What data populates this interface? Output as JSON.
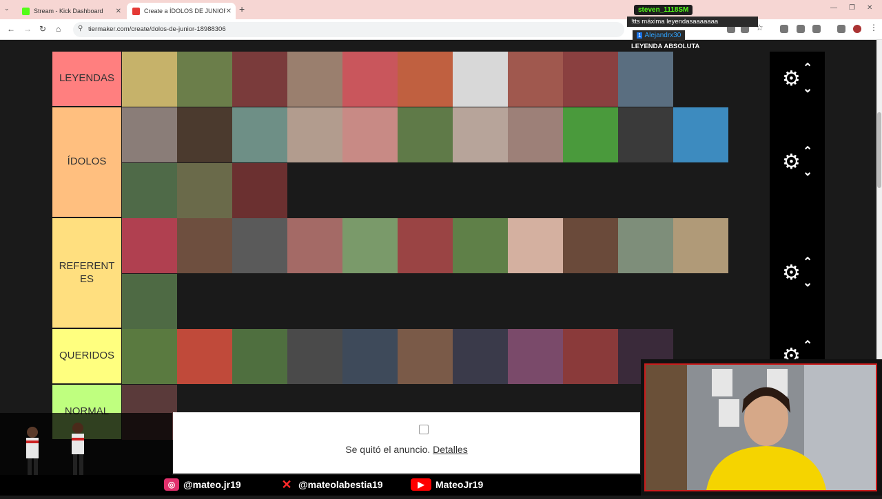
{
  "browser": {
    "tabs": [
      {
        "title": "Stream - Kick Dashboard",
        "favicon_color": "#53fc18"
      },
      {
        "title": "Create a ÍDOLOS DE JUNIOR Ti",
        "favicon_color": "#e53935"
      }
    ],
    "url": "tiermaker.com/create/dolos-de-junior-18988306"
  },
  "chat": {
    "user1": "steven_1118SM",
    "msg1": "!tts máxima leyendasaaaaaaa",
    "user2": "Alejandrx30",
    "badge": "1",
    "msg2": "LEYENDA ABSOLUTA"
  },
  "tiers": [
    {
      "label": "LEYENDAS",
      "color": "#ff7f7f",
      "count": 10
    },
    {
      "label": "ÍDOLOS",
      "color": "#ffbf7f",
      "count": 14
    },
    {
      "label": "REFERENTES",
      "label_display": "REFERENT ES",
      "color": "#ffdf7f",
      "count": 12
    },
    {
      "label": "QUERIDOS",
      "color": "#ffff7f",
      "count": 10
    },
    {
      "label": "NORMAL",
      "color": "#bfff7f",
      "count": 1
    }
  ],
  "ad": {
    "text": "Se quitó el anuncio.",
    "link": "Detalles"
  },
  "social": {
    "instagram": "@mateo.jr19",
    "x": "@mateolabestia19",
    "youtube": "MateoJr19"
  },
  "colors": {
    "accent_kick": "#53fc18",
    "youtube": "#ff0000",
    "instagram": "#e1306c"
  }
}
